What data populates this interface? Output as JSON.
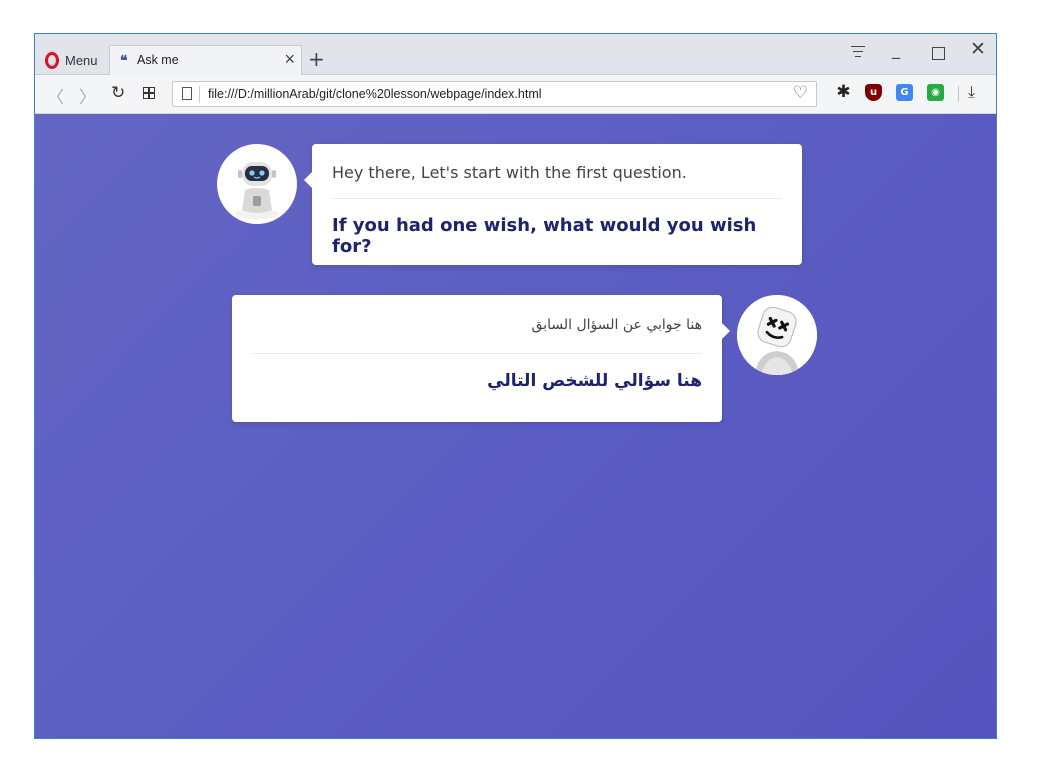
{
  "browser": {
    "menu_label": "Menu",
    "tab": {
      "title": "Ask me",
      "icon": "quote-icon"
    },
    "new_tab_symbol": "+",
    "url": "file:///D:/millionArab/git/clone%20lesson/webpage/index.html",
    "icons": [
      "back-icon",
      "forward-icon",
      "reload-icon",
      "speed-dial-icon",
      "page-icon",
      "heart-icon",
      "gear-icon",
      "ublock-icon",
      "translate-icon",
      "green-extension-icon",
      "download-icon"
    ]
  },
  "chat": {
    "bot": {
      "avatar": "robot-avatar",
      "greeting": "Hey there, Let's start with the first question.",
      "question": "If you had one wish, what would you wish for?"
    },
    "user": {
      "avatar": "marshmello-avatar",
      "answer": "هنا جوابي عن السؤال السابق",
      "next_question": "هنا سؤالي للشخص التالي"
    }
  },
  "colors": {
    "background_start": "#6466c4",
    "background_end": "#5653be",
    "question_text": "#1e2370",
    "card": "#ffffff"
  }
}
